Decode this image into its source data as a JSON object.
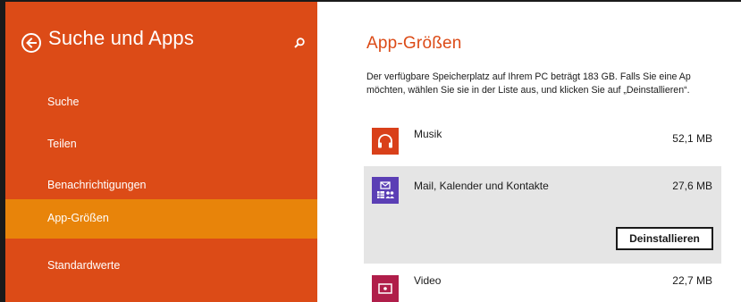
{
  "sidebar": {
    "title": "Suche und Apps",
    "back_icon": "back-arrow-icon",
    "search_icon": "search-icon",
    "items": [
      {
        "label": "Suche",
        "active": false
      },
      {
        "label": "Teilen",
        "active": false
      },
      {
        "label": "Benachrichtigungen",
        "active": false
      },
      {
        "label": "App-Größen",
        "active": true
      },
      {
        "label": "Standardwerte",
        "active": false
      }
    ]
  },
  "main": {
    "title": "App-Größen",
    "description_line1": "Der verfügbare Speicherplatz auf Ihrem PC beträgt 183 GB. Falls Sie eine Ap",
    "description_line2": "möchten, wählen Sie sie in der Liste aus, und klicken Sie auf „Deinstallieren“.",
    "apps": [
      {
        "name": "Musik",
        "size": "52,1 MB",
        "icon": "headphones-icon",
        "color": "#d9401a",
        "selected": false
      },
      {
        "name": "Mail, Kalender und Kontakte",
        "size": "27,6 MB",
        "icon": "mail-calendar-people-icon",
        "color": "#5b3fb5",
        "selected": true
      },
      {
        "name": "Video",
        "size": "22,7 MB",
        "icon": "video-icon",
        "color": "#b01e4a",
        "selected": false
      }
    ],
    "uninstall_label": "Deinstallieren"
  },
  "colors": {
    "sidebar_bg": "#dc4b17",
    "sidebar_active": "#e8840a",
    "accent_title": "#dc4b17",
    "selected_row": "#e5e5e5"
  }
}
